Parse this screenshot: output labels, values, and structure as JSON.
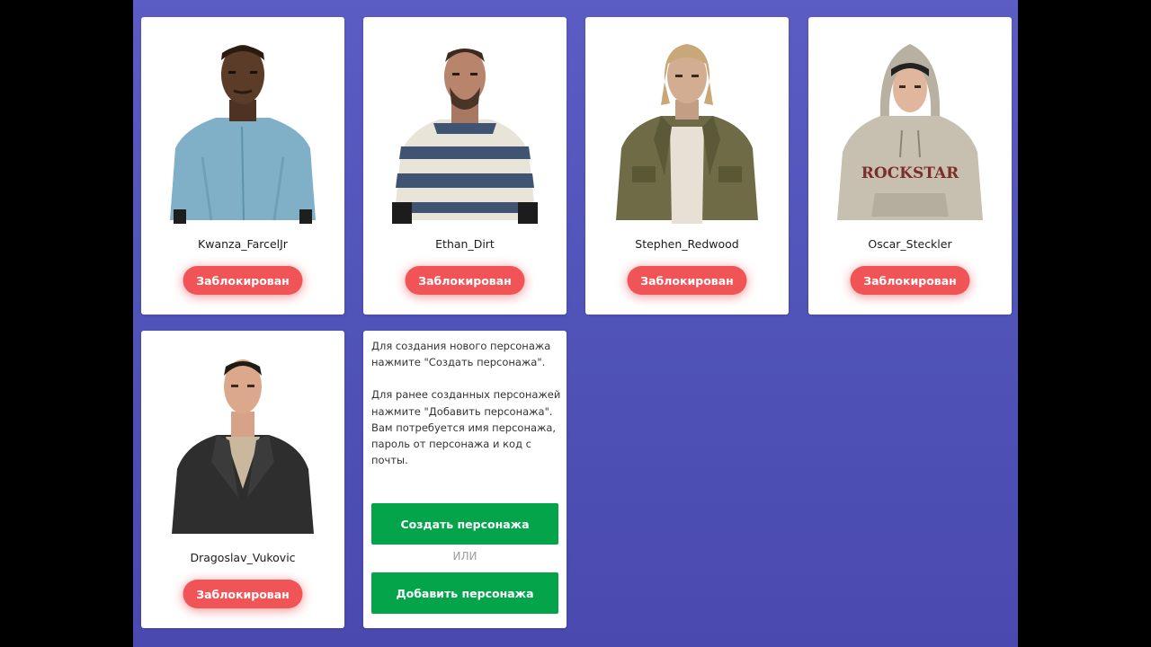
{
  "characters": [
    {
      "name": "Kwanza_FarcelJr",
      "status": "Заблокирован"
    },
    {
      "name": "Ethan_Dirt",
      "status": "Заблокирован"
    },
    {
      "name": "Stephen_Redwood",
      "status": "Заблокирован"
    },
    {
      "name": "Oscar_Steckler",
      "status": "Заблокирован",
      "hoodie_text": "ROCKSTAR"
    },
    {
      "name": "Dragoslav_Vukovic",
      "status": "Заблокирован"
    }
  ],
  "info": {
    "paragraph1": "Для создания нового персонажа нажмите \"Создать персонажа\".",
    "paragraph2": "Для ранее созданных персонажей нажмите \"Добавить персонажа\". Вам потребуется имя персонажа, пароль от персонажа и код с почты.",
    "create_label": "Создать персонажа",
    "or_label": "ИЛИ",
    "add_label": "Добавить персонажа"
  },
  "colors": {
    "background": "#5053b8",
    "blocked_button": "#f05457",
    "action_button": "#04a54a"
  }
}
